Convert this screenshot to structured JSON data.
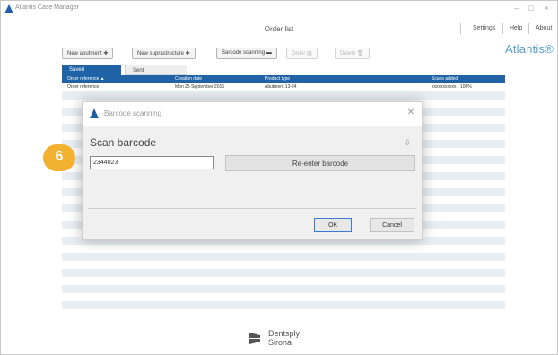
{
  "app": {
    "title": "Atlantis Case Manager",
    "window_title": "Order list",
    "brand": "Atlantis®",
    "colors": {
      "accent": "#1f63a6",
      "badge": "#f3b132",
      "brand": "#5aa0c8"
    }
  },
  "header": {
    "settings": "Settings",
    "help": "Help",
    "about": "About"
  },
  "toolbar": {
    "new_abutment": "New abutment ✚",
    "new_suprastructure": "New suprastructure ✚",
    "barcode_scanning": "Barcode scanning ▬",
    "btn4": "Order ▤",
    "btn5": "Delete 🗑"
  },
  "tabs": {
    "saved": "Saved",
    "sent": "Sent"
  },
  "table": {
    "headers": [
      "Order reference ▲",
      "Creation date",
      "Product type",
      "Scans added"
    ],
    "rows": [
      [
        "Order reference",
        "Mon 25 September 2015",
        "Abutment 13-24",
        "xxxxxxxxxxx - 100%"
      ]
    ]
  },
  "dialog": {
    "title": "Barcode scanning",
    "close_icon": "✕",
    "heading": "Scan barcode",
    "info_icon": "⇩",
    "barcode_value": "2344023",
    "reenter_label": "Re-enter barcode",
    "ok_label": "OK",
    "cancel_label": "Cancel"
  },
  "badge": {
    "step": "6"
  },
  "footer": {
    "word1": "Dentsply",
    "word2": "Sirona"
  }
}
